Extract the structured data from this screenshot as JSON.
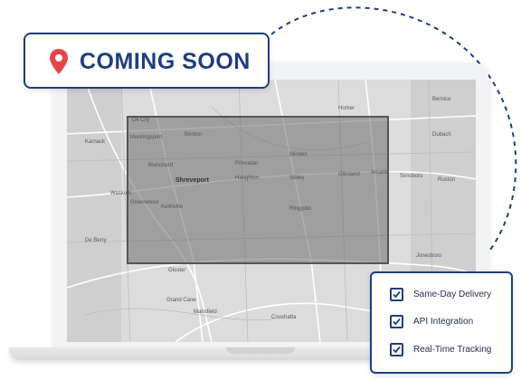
{
  "badge": {
    "text": "COMING SOON",
    "icon": "map-pin-icon",
    "color": "#1f3e7c",
    "pin_color": "#e8454a"
  },
  "features": [
    {
      "label": "Same-Day Delivery",
      "checked": true,
      "icon": "checkbox-checked-icon"
    },
    {
      "label": "API Integration",
      "checked": true,
      "icon": "checkbox-checked-icon"
    },
    {
      "label": "Real-Time Tracking",
      "checked": true,
      "icon": "checkbox-checked-icon"
    }
  ],
  "map": {
    "labels": {
      "oil_city": "Oil City",
      "mooringsport": "Mooringsport",
      "benton": "Benton",
      "karnack": "Karnack",
      "blanchard": "Blanchard",
      "shreveport": "Shreveport",
      "princeton": "Princeton",
      "haughton": "Haughton",
      "minden": "Minden",
      "sibley": "Sibley",
      "gibsland": "Gibsland",
      "arcadia": "Arcadia",
      "homer": "Homer",
      "bernice": "Bernice",
      "dubach": "Dubach",
      "simsboro": "Simsboro",
      "ruston": "Ruston",
      "waskom": "Waskom",
      "greenwood": "Greenwood",
      "de_berry": "De Berry",
      "keithville": "Keithville",
      "ringgold": "Ringgold",
      "jonesboro": "Jonesboro",
      "gloster": "Gloster",
      "grand_cane": "Grand Cane",
      "mansfield": "Mansfield",
      "coushatta": "Coushatta"
    }
  }
}
